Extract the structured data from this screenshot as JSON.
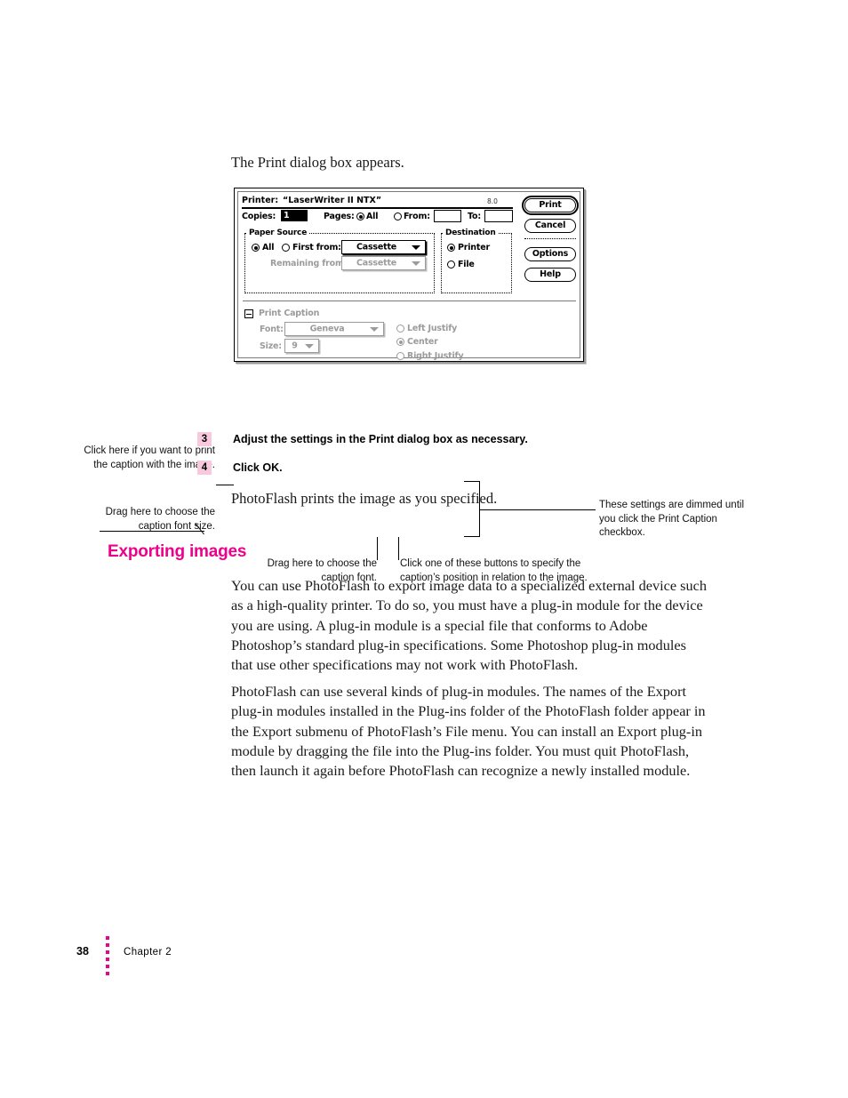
{
  "page": {
    "intro_line": "The Print dialog box appears.",
    "after_steps_line": "PhotoFlash prints the image as you specified.",
    "section_heading": "Exporting images"
  },
  "dialog": {
    "printer_label": "Printer:",
    "printer_name": "“LaserWriter II NTX”",
    "version": "8.0",
    "copies_label": "Copies:",
    "copies_value": "1",
    "pages_label": "Pages:",
    "pages_all_label": "All",
    "pages_from_label": "From:",
    "pages_from_value": "",
    "pages_to_label": "To:",
    "pages_to_value": "",
    "paper_source": {
      "title": "Paper Source",
      "all_label": "All",
      "first_from_label": "First from:",
      "first_from_value": "Cassette",
      "remaining_from_label": "Remaining from:",
      "remaining_from_value": "Cassette"
    },
    "destination": {
      "title": "Destination",
      "printer_label": "Printer",
      "file_label": "File"
    },
    "buttons": {
      "print": "Print",
      "cancel": "Cancel",
      "options": "Options",
      "help": "Help"
    },
    "print_caption": {
      "checkbox_label": "Print Caption",
      "font_label": "Font:",
      "font_value": "Geneva",
      "size_label": "Size:",
      "size_value": "9",
      "left_justify_label": "Left Justify",
      "center_label": "Center",
      "right_justify_label": "Right Justify"
    }
  },
  "callouts": {
    "checkbox": "Click here if you want to print the caption with the image.",
    "font_size": "Drag here to choose the caption font size.",
    "dimmed": "These settings are dimmed until you click the Print Caption checkbox.",
    "font": "Drag here to choose the caption font.",
    "position": "Click one of these buttons to specify the caption’s position in relation to the image."
  },
  "steps": [
    {
      "number": "3",
      "text": "Adjust the settings in the Print dialog box as necessary."
    },
    {
      "number": "4",
      "text": "Click OK."
    }
  ],
  "paragraphs": {
    "p1": "You can use PhotoFlash to export image data to a specialized external device such as a high-quality printer. To do so, you must have a plug-in module for the device you are using. A plug-in module is a special file that conforms to Adobe Photoshop’s standard plug-in specifications. Some Photoshop plug-in modules that use other specifications may not work with PhotoFlash.",
    "p2": "PhotoFlash can use several kinds of plug-in modules. The names of the Export plug-in modules installed in the Plug-ins folder of the PhotoFlash folder appear in the Export submenu of PhotoFlash’s File menu. You can install an Export plug-in module by dragging the file into the Plug-ins folder. You must quit PhotoFlash, then launch it again before PhotoFlash can recognize a newly installed module."
  },
  "footer": {
    "page_number": "38",
    "chapter": "Chapter 2"
  },
  "colors": {
    "heading_pink": "#ec008c",
    "step_badge": "#f7c9de",
    "dimmed_gray": "#9b9b9b"
  }
}
